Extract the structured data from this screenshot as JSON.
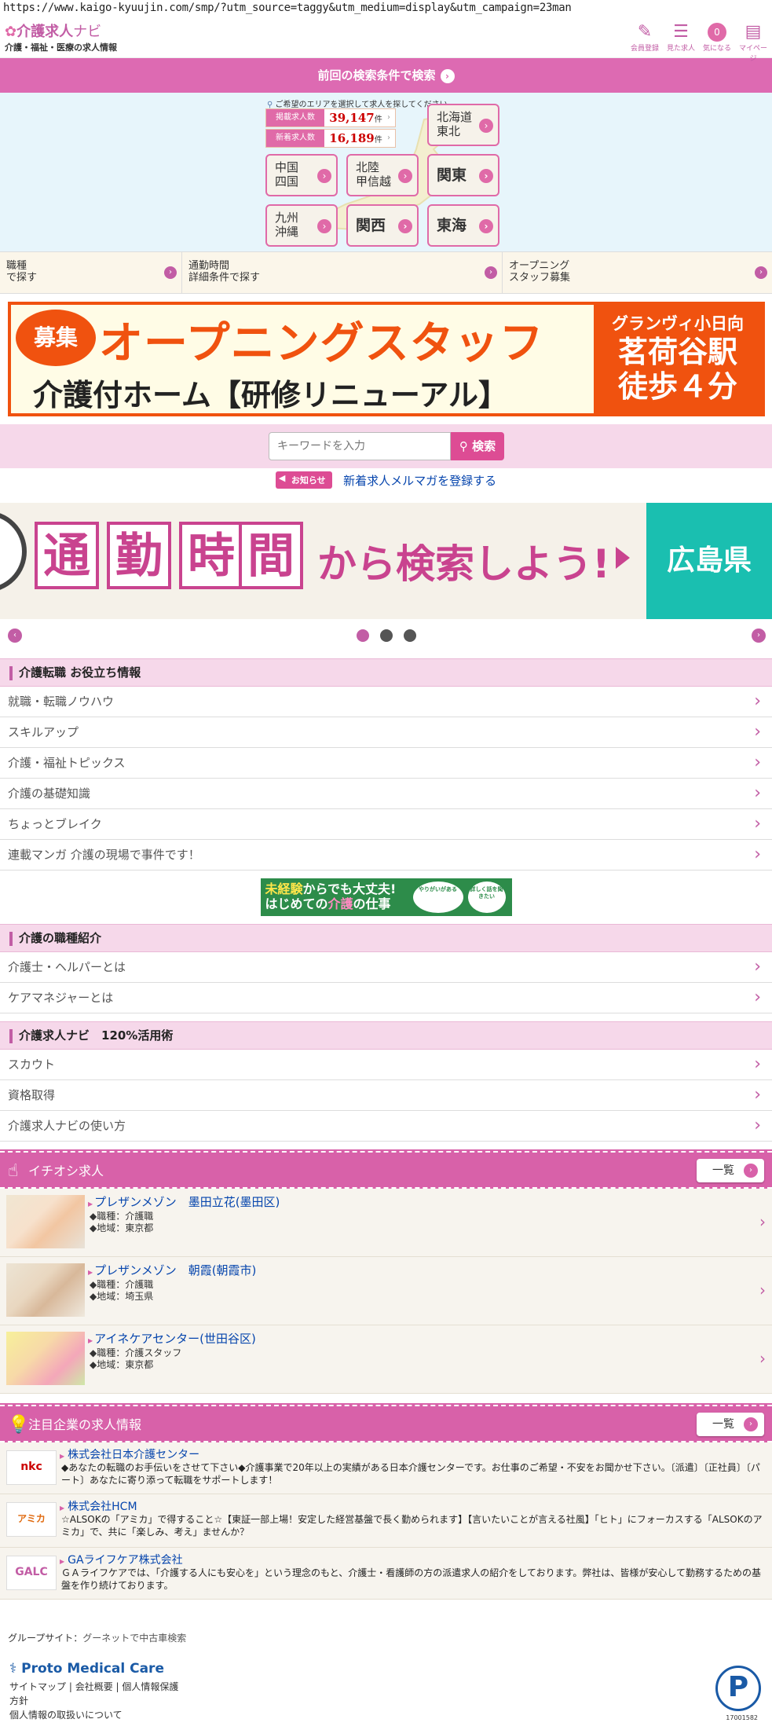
{
  "url": "https://www.kaigo-kyuujin.com/smp/?utm_source=taggy&utm_medium=display&utm_campaign=23man",
  "header": {
    "logo_main": "介護求人",
    "logo_navi": "ナビ",
    "logo_sub": "介護・福祉・医療の求人情報",
    "icons": [
      {
        "label": "会員登録",
        "icon": "pencil-icon"
      },
      {
        "label": "見た求人",
        "icon": "history-icon"
      },
      {
        "label": "気になる",
        "icon": "heart-icon",
        "badge": "0"
      },
      {
        "label": "マイページ",
        "icon": "mypage-icon"
      }
    ]
  },
  "prev_search": "前回の検索条件で検索",
  "area": {
    "note": "ご希望のエリアを選択して求人を探してください。",
    "counts": [
      {
        "label": "掲載求人数",
        "value": "39,147",
        "unit": "件"
      },
      {
        "label": "新着求人数",
        "value": "16,189",
        "unit": "件"
      }
    ],
    "regions": [
      {
        "l1": "北海道",
        "l2": "東北"
      },
      {
        "l1": "中国",
        "l2": "四国"
      },
      {
        "l1": "北陸",
        "l2": "甲信越"
      },
      {
        "l1": "関東",
        "l2": ""
      },
      {
        "l1": "九州",
        "l2": "沖縄"
      },
      {
        "l1": "関西",
        "l2": ""
      },
      {
        "l1": "東海",
        "l2": ""
      }
    ]
  },
  "search_options": [
    {
      "l1": "職種",
      "l2": "で探す"
    },
    {
      "l1": "通勤時間",
      "l2": "詳細条件で探す"
    },
    {
      "l1": "オープニング",
      "l2": "スタッフ募集"
    }
  ],
  "banner1": {
    "badge": "募集",
    "title": "オープニングスタッフ",
    "sub": "介護付ホーム【研修リニューアル】",
    "right_a": "グランヴィ小日向",
    "right_b1": "茗荷谷駅",
    "right_b2": "徒歩４分"
  },
  "keyword": {
    "placeholder": "キーワードを入力",
    "button": "検索"
  },
  "notice": {
    "tag": "お知らせ",
    "link": "新着求人メルマガを登録する"
  },
  "slider": {
    "kanji": [
      "通",
      "勤",
      "時",
      "間"
    ],
    "rest": "から検索しよう!",
    "side": "広島県"
  },
  "sections": [
    {
      "title": "介護転職 お役立ち情報",
      "items": [
        "就職・転職ノウハウ",
        "スキルアップ",
        "介護・福祉トピックス",
        "介護の基礎知識",
        "ちょっとブレイク",
        "連載マンガ 介護の現場で事件です！"
      ]
    },
    {
      "title": "介護の職種紹介",
      "items": [
        "介護士・ヘルパーとは",
        "ケアマネジャーとは"
      ]
    },
    {
      "title": "介護求人ナビ　120%活用術",
      "items": [
        "スカウト",
        "資格取得",
        "介護求人ナビの使い方"
      ]
    }
  ],
  "banner2": {
    "l1a": "未経験",
    "l1b": "からでも大丈夫!",
    "l2a": "はじめての",
    "l2b": "介護",
    "l2c": "の仕事",
    "bubble": "やりがいがある",
    "bubble2": "詳しく話を聞きたい"
  },
  "pickup": {
    "title": "イチオシ求人",
    "all": "一覧",
    "jobs": [
      {
        "name": "プレザンメゾン　墨田立花(墨田区)",
        "job": "◆職種：介護職",
        "area": "◆地域：東京都"
      },
      {
        "name": "プレザンメゾン　朝霞(朝霞市)",
        "job": "◆職種：介護職",
        "area": "◆地域：埼玉県"
      },
      {
        "name": "アイネケアセンター(世田谷区)",
        "job": "◆職種：介護スタッフ",
        "area": "◆地域：東京都"
      }
    ]
  },
  "companies": {
    "title": "注目企業の求人情報",
    "all": "一覧",
    "items": [
      {
        "logo": "nkc",
        "name": "株式会社日本介護センター",
        "desc": "◆あなたの転職のお手伝いをさせて下さい◆介護事業で20年以上の実績がある日本介護センターです。お仕事のご希望・不安をお聞かせ下さい。〔派遣〕〔正社員〕〔パート〕あなたに寄り添って転職をサポートします！"
      },
      {
        "logo": "アミカ",
        "name": "株式会社HCM",
        "desc": "☆ALSOKの「アミカ」で得すること☆【東証一部上場！安定した経営基盤で長く勤められます】【言いたいことが言える社風】「ヒト」にフォーカスする「ALSOKのアミカ」で、共に「楽しみ、考え」ませんか？"
      },
      {
        "logo": "GALC",
        "name": "GAライフケア株式会社",
        "desc": "ＧＡライフケアでは、「介護する人にも安心を」という理念のもと、介護士・看護師の方の派遣求人の紹介をしております。弊社は、皆様が安心して勤務するための基盤を作り続けております。"
      }
    ]
  },
  "footer": {
    "group_label": "グループサイト：",
    "group_link": "グーネットで中古車検索",
    "company": "Proto Medical Care",
    "links": [
      "サイトマップ",
      "会社概要",
      "個人情報保護",
      "方針",
      "個人情報の取扱いについて"
    ],
    "pmark": "P",
    "pmark_num": "17001582"
  }
}
